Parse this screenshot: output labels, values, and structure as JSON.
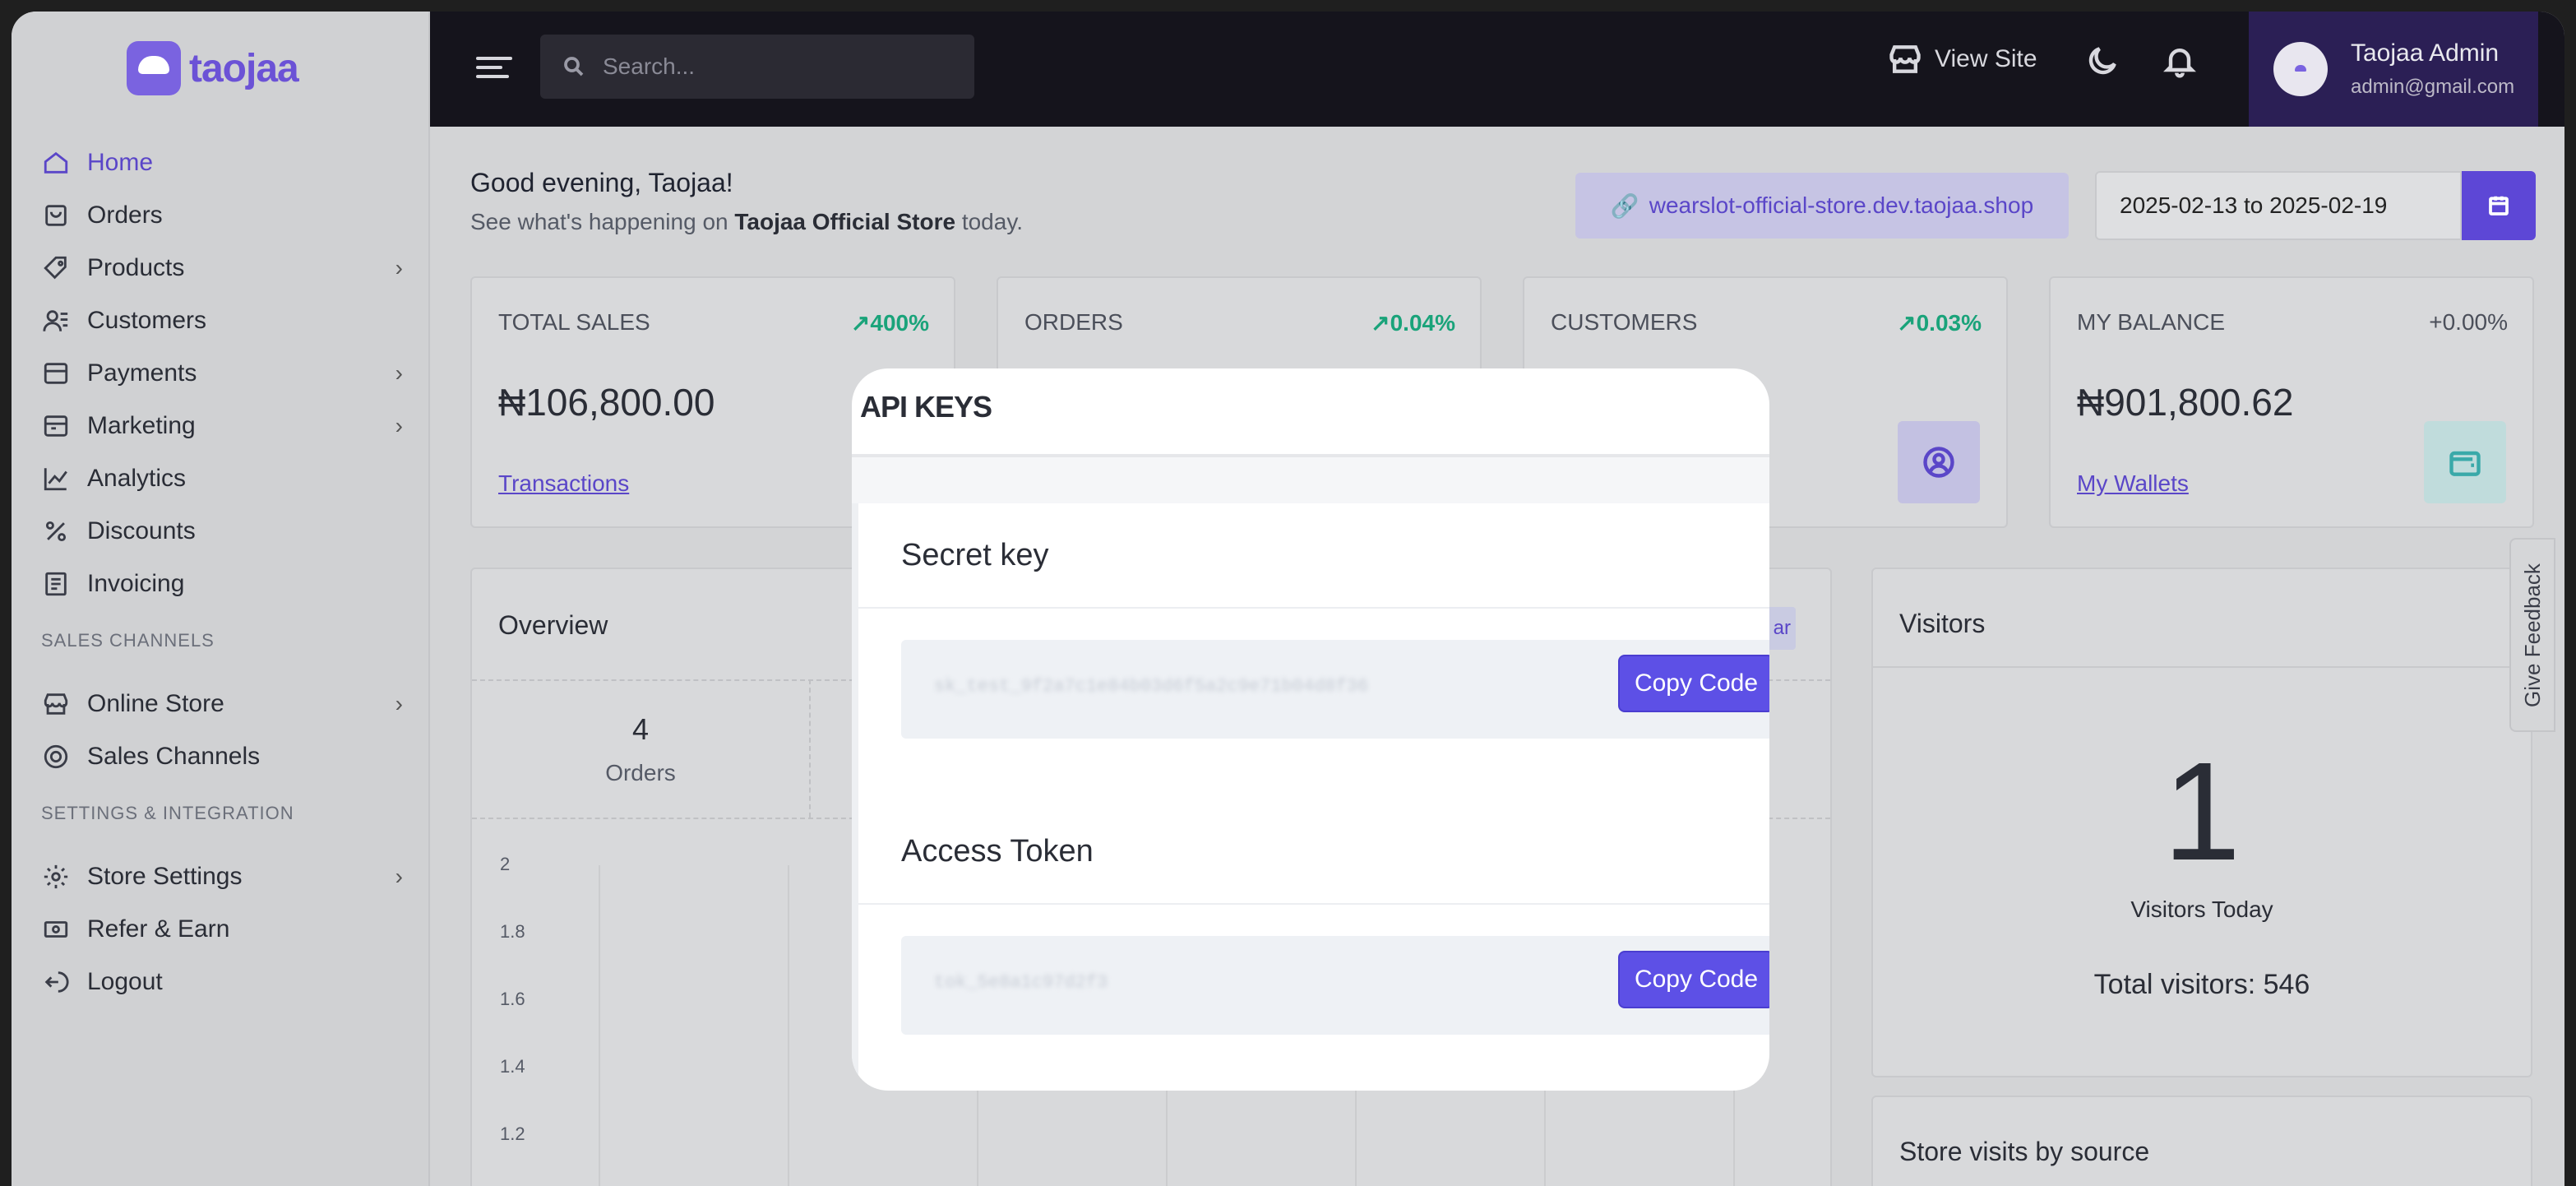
{
  "brand": {
    "name": "taojaa"
  },
  "sidebar": {
    "items": [
      {
        "label": "Home",
        "icon": "home-icon",
        "active": true
      },
      {
        "label": "Orders",
        "icon": "bag-icon"
      },
      {
        "label": "Products",
        "icon": "tag-icon",
        "chevron": true
      },
      {
        "label": "Customers",
        "icon": "users-icon"
      },
      {
        "label": "Payments",
        "icon": "card-icon",
        "chevron": true
      },
      {
        "label": "Marketing",
        "icon": "megaphone-icon",
        "chevron": true
      },
      {
        "label": "Analytics",
        "icon": "chart-icon"
      },
      {
        "label": "Discounts",
        "icon": "percent-icon"
      },
      {
        "label": "Invoicing",
        "icon": "invoice-icon"
      }
    ],
    "sales_channels_heading": "SALES CHANNELS",
    "sales_items": [
      {
        "label": "Online Store",
        "icon": "store-icon",
        "chevron": true
      },
      {
        "label": "Sales Channels",
        "icon": "channels-icon"
      }
    ],
    "settings_heading": "SETTINGS & INTEGRATION",
    "settings_items": [
      {
        "label": "Store Settings",
        "icon": "gear-icon",
        "chevron": true
      },
      {
        "label": "Refer & Earn",
        "icon": "cash-icon"
      },
      {
        "label": "Logout",
        "icon": "logout-icon"
      }
    ]
  },
  "topbar": {
    "search_placeholder": "Search...",
    "view_site": "View Site",
    "user_name": "Taojaa Admin",
    "user_email": "admin@gmail.com"
  },
  "main": {
    "greeting": "Good evening, Taojaa!",
    "subgreeting_prefix": "See what's happening on",
    "store_name": "Taojaa Official Store",
    "subgreeting_suffix": "today.",
    "store_link": "wearslot-official-store.dev.taojaa.shop",
    "date_range": "2025-02-13 to 2025-02-19"
  },
  "cards": [
    {
      "label": "TOTAL SALES",
      "pct": "400%",
      "value": "₦106,800.00",
      "link": "Transactions"
    },
    {
      "label": "ORDERS",
      "pct": "0.04%"
    },
    {
      "label": "CUSTOMERS",
      "pct": "0.03%"
    },
    {
      "label": "MY BALANCE",
      "pct": "+0.00%",
      "value": "₦901,800.62",
      "link": "My Wallets"
    }
  ],
  "overview": {
    "title": "Overview",
    "pill": "ar",
    "stat_value": "4",
    "stat_label": "Orders",
    "y_ticks": [
      "2",
      "1.8",
      "1.6",
      "1.4",
      "1.2"
    ]
  },
  "visitors": {
    "title": "Visitors",
    "count": "1",
    "today_label": "Visitors Today",
    "total": "Total visitors: 546"
  },
  "store_visits": {
    "title": "Store visits by source"
  },
  "feedback": "Give Feedback",
  "modal": {
    "title": "API KEYS",
    "secret_heading": "Secret key",
    "secret_value": "sk_test_9f2a7c1e84b03d6f5a2c9e71b04d8f36",
    "access_heading": "Access Token",
    "access_value": "tok_5e8a1c97d2f3",
    "copy_label": "Copy Code"
  },
  "colors": {
    "accent": "#5d47d6",
    "success": "#1aa37a",
    "topbar": "#15141c"
  }
}
